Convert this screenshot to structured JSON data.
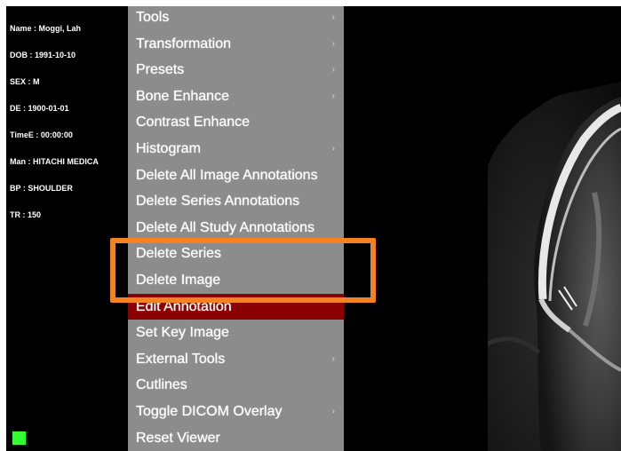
{
  "overlay": {
    "lines": [
      "Name : Moggi, Lah",
      "DOB : 1991-10-10",
      "SEX : M",
      "DE : 1900-01-01",
      "TimeE : 00:00:00",
      "Man : HITACHI MEDICA",
      "BP : SHOULDER",
      "TR : 150"
    ]
  },
  "menu": {
    "items": [
      {
        "label": "Tools",
        "has_submenu": true
      },
      {
        "label": "Transformation",
        "has_submenu": true
      },
      {
        "label": "Presets",
        "has_submenu": true
      },
      {
        "label": "Bone Enhance",
        "has_submenu": true
      },
      {
        "label": "Contrast Enhance",
        "has_submenu": false
      },
      {
        "label": "Histogram",
        "has_submenu": true
      },
      {
        "label": "Delete All Image Annotations",
        "has_submenu": false
      },
      {
        "label": "Delete Series Annotations",
        "has_submenu": false
      },
      {
        "label": "Delete All Study Annotations",
        "has_submenu": false
      },
      {
        "label": "Delete Series",
        "has_submenu": false
      },
      {
        "label": "Delete Image",
        "has_submenu": false
      },
      {
        "label": "Edit Annotation",
        "has_submenu": false,
        "selected": true
      },
      {
        "label": "Set Key Image",
        "has_submenu": false
      },
      {
        "label": "External Tools",
        "has_submenu": true
      },
      {
        "label": "Cutlines",
        "has_submenu": false
      },
      {
        "label": "Toggle DICOM Overlay",
        "has_submenu": true
      },
      {
        "label": "Reset Viewer",
        "has_submenu": false
      }
    ],
    "submenu_arrow": "›"
  },
  "colors": {
    "menu_background": "#8c8c8c",
    "selected_item": "#8b0000",
    "highlight_box": "#f58220",
    "status_indicator": "#33ff33",
    "viewer_background": "#000000"
  },
  "icons": {
    "submenu_arrow": "chevron-right-icon"
  }
}
